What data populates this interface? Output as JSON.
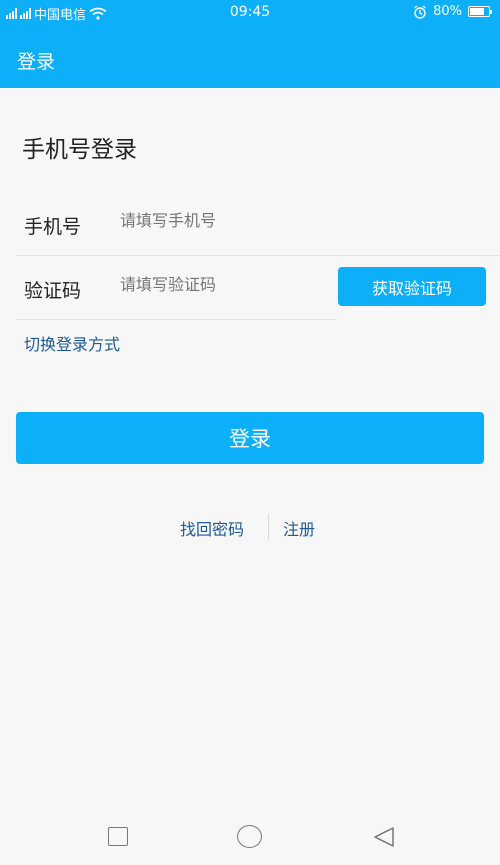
{
  "statusbar": {
    "carrier": "中国电信",
    "time": "09:45",
    "battery": "80%",
    "battery_level": 0.8
  },
  "header": {
    "title": "登录"
  },
  "page": {
    "heading": "手机号登录"
  },
  "phone": {
    "label": "手机号",
    "placeholder": "请填写手机号",
    "value": ""
  },
  "code": {
    "label": "验证码",
    "placeholder": "请填写验证码",
    "value": "",
    "button": "获取验证码"
  },
  "switch_link": "切换登录方式",
  "login_button": "登录",
  "links": {
    "forgot": "找回密码",
    "register": "注册"
  },
  "colors": {
    "primary": "#0db0f8",
    "link": "#1d5a96",
    "background": "#f7f7f7"
  },
  "icons": {
    "signal": "signal-icon",
    "wifi": "wifi-icon",
    "alarm": "alarm-icon",
    "battery": "battery-icon",
    "nav_recent": "square-icon",
    "nav_home": "circle-icon",
    "nav_back": "triangle-back-icon"
  }
}
